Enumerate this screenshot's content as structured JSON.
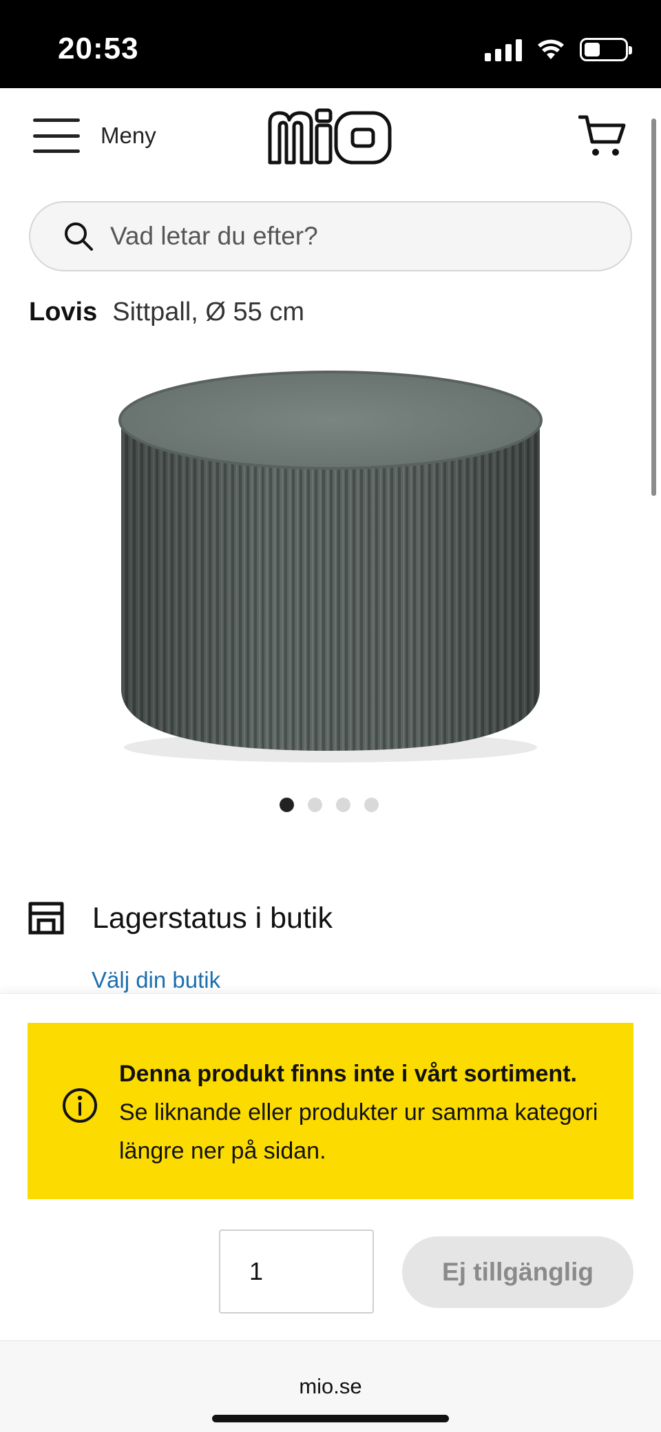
{
  "status_bar": {
    "time": "20:53"
  },
  "header": {
    "menu_label": "Meny",
    "logo_text": "mio"
  },
  "search": {
    "placeholder": "Vad letar du efter?"
  },
  "product": {
    "name": "Lovis",
    "subtitle": "Sittpall, Ø 55 cm",
    "image_count": 4,
    "active_image_index": 0,
    "color": "#5b6461"
  },
  "stock": {
    "title": "Lagerstatus i butik",
    "store_link": "Välj din butik"
  },
  "notice": {
    "title": "Denna produkt finns inte i vårt sortiment.",
    "text": "Se liknande eller produkter ur samma kategori längre ner på sidan.",
    "background": "#fcdb00"
  },
  "purchase": {
    "quantity": "1",
    "button_label": "Ej tillgänglig"
  },
  "browser": {
    "url": "mio.se"
  },
  "icons": [
    "hamburger-icon",
    "cart-icon",
    "search-icon",
    "store-icon",
    "info-icon",
    "wifi-icon",
    "signal-icon",
    "battery-icon"
  ]
}
